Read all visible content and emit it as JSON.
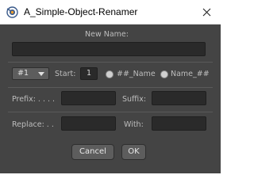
{
  "window": {
    "title": "A_Simple-Object-Renamer",
    "app_icon": "blender-icon",
    "close_icon": "close-icon"
  },
  "form": {
    "new_name_label": "New Name:",
    "new_name_value": "",
    "numbering_option": "#1",
    "start_label": "Start:",
    "start_value": "1",
    "suffix_option_label": "##_Name",
    "prefix_option_label": "Name_##",
    "prefix_label": "Prefix: . . . .",
    "prefix_value": "",
    "suffix_label": "Suffix:",
    "suffix_value": "",
    "replace_label": "Replace: . .",
    "replace_value": "",
    "with_label": "With:",
    "with_value": ""
  },
  "buttons": {
    "cancel": "Cancel",
    "ok": "OK"
  },
  "colors": {
    "panel_bg": "#444444",
    "field_bg": "#2a2a2a",
    "button_bg": "#5d5d5d"
  }
}
